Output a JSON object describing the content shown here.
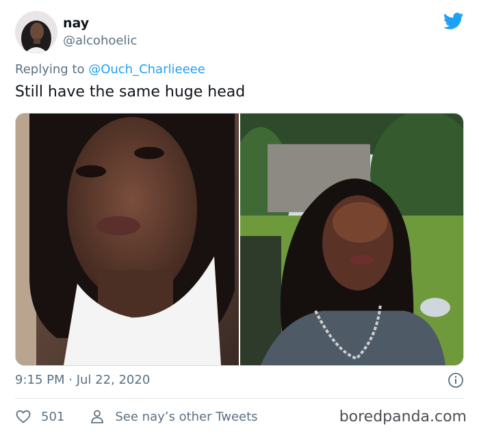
{
  "tweet": {
    "display_name": "nay",
    "handle": "@alcohoelic",
    "reply_prefix": "Replying to ",
    "reply_to": "@Ouch_Charlieeee",
    "text": "Still have the same huge head",
    "timestamp": "9:15 PM · Jul 22, 2020",
    "likes": "501",
    "see_other": "See nay’s other Tweets"
  },
  "watermark": "boredpanda.com",
  "icons": {
    "brand": "twitter-bird-icon",
    "info": "info-icon",
    "like": "heart-icon",
    "profile": "person-icon"
  },
  "colors": {
    "twitter_blue": "#1da1f2",
    "secondary_text": "#5b7083",
    "primary_text": "#0f1419"
  }
}
